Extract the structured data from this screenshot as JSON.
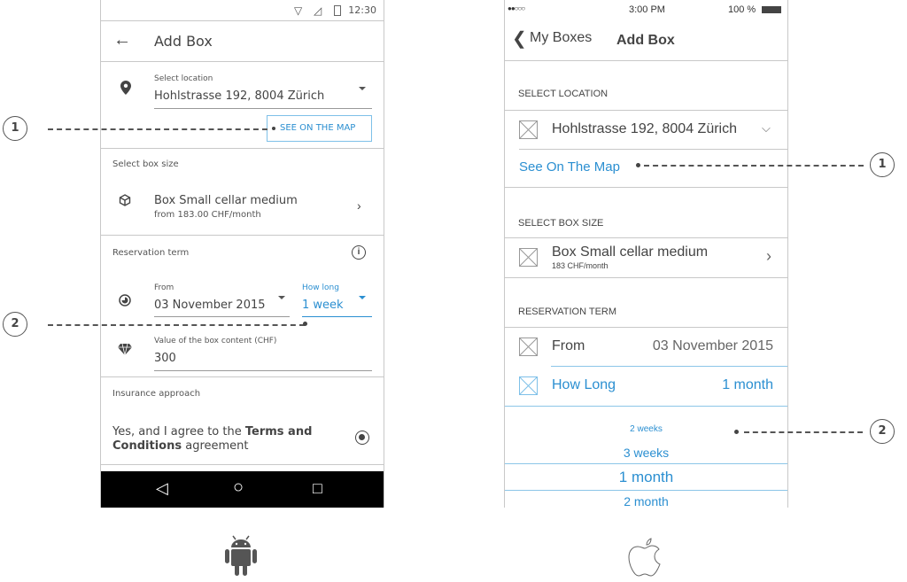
{
  "android": {
    "status": {
      "time": "12:30",
      "icons": [
        "wifi-icon",
        "signal-icon",
        "battery-icon"
      ]
    },
    "appbar": {
      "title": "Add Box"
    },
    "location": {
      "label": "Select location",
      "value": "Hohlstrasse 192, 8004 Zürich",
      "map_button": "SEE ON THE MAP"
    },
    "box_size": {
      "section": "Select box size",
      "name": "Box Small cellar medium",
      "price": "from 183.00 CHF/month"
    },
    "reservation": {
      "section": "Reservation term",
      "from_label": "From",
      "from_value": "03 November 2015",
      "how_long_label": "How long",
      "how_long_value": "1 week"
    },
    "content_value": {
      "label": "Value of the box content (CHF)",
      "value": "300"
    },
    "insurance": {
      "section": "Insurance approach",
      "text_prefix": "Yes, and I agree to the ",
      "text_bold1": "Terms and",
      "text_bold2": "Conditions",
      "text_suffix": " agreement",
      "selected": true
    },
    "navbar": {
      "back": "◁",
      "home": "○",
      "recents": "□"
    }
  },
  "ios": {
    "status": {
      "signal": "●●○○○",
      "time": "3:00 PM",
      "battery": "100 %"
    },
    "navbar": {
      "back_label": "My Boxes",
      "title": "Add Box"
    },
    "location": {
      "section": "SELECT LOCATION",
      "value": "Hohlstrasse 192, 8004 Zürich",
      "map_link": "See On The Map"
    },
    "box_size": {
      "section": "SELECT BOX SIZE",
      "name": "Box Small cellar medium",
      "price": "183 CHF/month"
    },
    "reservation": {
      "section": "RESERVATION TERM",
      "from_label": "From",
      "from_value": "03 November 2015",
      "how_long_label": "How Long",
      "how_long_value": "1 month"
    },
    "picker": {
      "options": [
        "2 weeks",
        "3 weeks",
        "1 month",
        "2 month"
      ],
      "selected": "1 month"
    }
  },
  "callouts": {
    "one": "1",
    "two": "2"
  },
  "colors": {
    "accent": "#2b8fd1",
    "text": "#444444",
    "divider": "#c8c8c8"
  }
}
